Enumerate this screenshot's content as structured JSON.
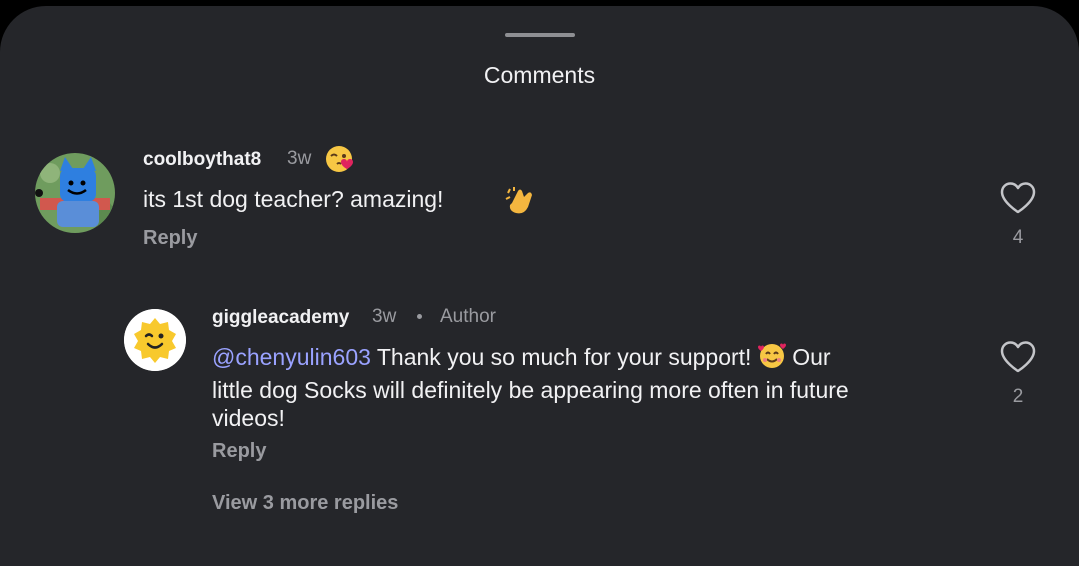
{
  "sheet": {
    "title": "Comments"
  },
  "comments": [
    {
      "username": "coolboythat8",
      "time": "3w",
      "text": "its 1st dog teacher?  amazing!",
      "reply_label": "Reply",
      "like_count": "4"
    }
  ],
  "reply": {
    "username": "giggleacademy",
    "time": "3w",
    "separator": "•",
    "badge": "Author",
    "mention": "@chenyulin603",
    "text_line1": " Thank you so much for your support! ",
    "text_line1_tail": " Our",
    "text_line2": "little dog Socks will definitely be appearing more often in future",
    "text_line3": "videos!",
    "reply_label": "Reply",
    "like_count": "2"
  },
  "view_more": "View 3 more replies",
  "icons": [
    "heart-outline-icon",
    "clapping-hands-emoji",
    "smiling-face-with-hearts-emoji",
    "winking-kiss-emoji"
  ],
  "colors": {
    "background": "#25262a",
    "mention": "#9aa2ff",
    "muted": "#9a9ba0",
    "text": "#f1f1f3"
  }
}
